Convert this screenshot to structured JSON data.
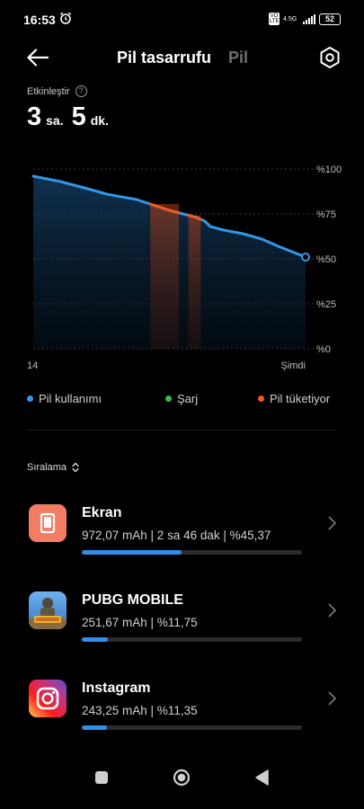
{
  "status_bar": {
    "time": "16:53",
    "alarm_icon": "alarm-icon",
    "volte": "VO LTE",
    "network": "4.5G",
    "battery": "52"
  },
  "header": {
    "active_tab": "Pil tasarrufu",
    "inactive_tab": "Pil",
    "back_icon": "arrow-left-icon",
    "settings_icon": "settings-gear-icon"
  },
  "estimate": {
    "label": "Etkinleştir",
    "hours": "3",
    "hours_unit": "sa.",
    "minutes": "5",
    "minutes_unit": "dk."
  },
  "chart_data": {
    "type": "area",
    "y_tick_labels": [
      "%100",
      "%75",
      "%50",
      "%25",
      "%0"
    ],
    "x_tick_labels": [
      "14",
      "Şimdi"
    ],
    "ylim": [
      0,
      100
    ],
    "x": [
      0,
      0.1,
      0.2,
      0.27,
      0.38,
      0.44,
      0.5,
      0.55,
      0.6,
      0.63,
      0.65,
      0.7,
      0.77,
      0.84,
      0.9,
      0.95,
      1.0
    ],
    "series": [
      {
        "name": "Pil kullanımı",
        "values": [
          96,
          93,
          89,
          86,
          83,
          80,
          77,
          75,
          73,
          71,
          68,
          66,
          64,
          61,
          57,
          54,
          51
        ]
      }
    ],
    "drain_intervals": [
      [
        0.43,
        0.535
      ],
      [
        0.57,
        0.615
      ]
    ],
    "colors": {
      "usage": "#3595e6",
      "charge": "#2fbf4b",
      "drain": "#f05a24"
    }
  },
  "legend": [
    {
      "label": "Pil kullanımı",
      "color": "#3595e6"
    },
    {
      "label": "Şarj",
      "color": "#2fbf4b"
    },
    {
      "label": "Pil tüketiyor",
      "color": "#f05a24"
    }
  ],
  "sort_label": "Sıralama",
  "apps": [
    {
      "name": "Ekran",
      "detail": "972,07 mAh | 2 sa 46 dak  | %45,37",
      "percent": 45.37,
      "icon": "screen-icon",
      "icon_bg": "#f27d62"
    },
    {
      "name": "PUBG MOBILE",
      "detail": "251,67 mAh | %11,75",
      "percent": 11.75,
      "icon": "pubg-mobile-icon",
      "icon_bg": "#4a8fd8"
    },
    {
      "name": "Instagram",
      "detail": "243,25 mAh | %11,35",
      "percent": 11.35,
      "icon": "instagram-icon",
      "icon_bg": "#d62f7c"
    }
  ],
  "nav": {
    "recents_icon": "recents-square-icon",
    "home_icon": "home-circle-icon",
    "back_icon": "back-triangle-icon"
  }
}
